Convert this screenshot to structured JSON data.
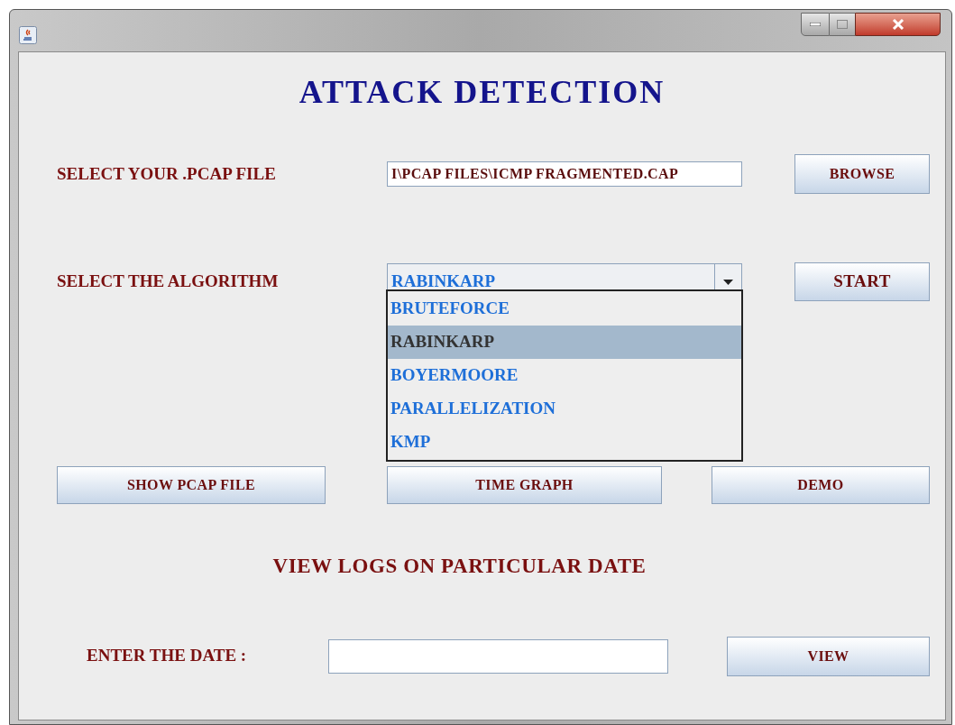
{
  "title": "ATTACK DETECTION",
  "file_row": {
    "label": "SELECT YOUR .PCAP FILE",
    "value": "I\\PCAP FILES\\ICMP FRAGMENTED.CAP",
    "button": "BROWSE"
  },
  "algorithm_row": {
    "label": "SELECT THE ALGORITHM",
    "value": "RABINKARP",
    "button": "START",
    "expanded": true,
    "options": [
      {
        "label": "BRUTEFORCE",
        "selected": false
      },
      {
        "label": "RABINKARP",
        "selected": true
      },
      {
        "label": "BOYERMOORE",
        "selected": false
      },
      {
        "label": "PARALLELIZATION",
        "selected": false
      },
      {
        "label": "KMP",
        "selected": false
      }
    ]
  },
  "action_buttons": [
    "SHOW PCAP FILE",
    "TIME GRAPH",
    "DEMO"
  ],
  "logs_heading": "VIEW LOGS ON PARTICULAR DATE",
  "date_row": {
    "label": "ENTER THE DATE :",
    "button": "VIEW"
  }
}
